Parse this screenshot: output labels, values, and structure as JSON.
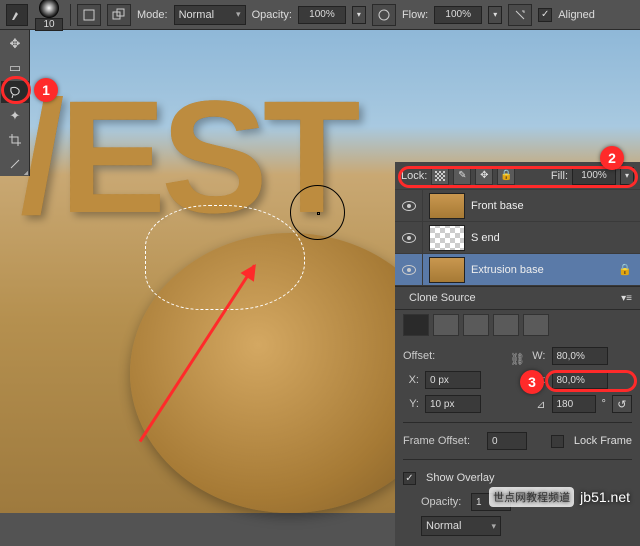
{
  "optbar": {
    "brush_size": "10",
    "mode_label": "Mode:",
    "mode_value": "Normal",
    "opacity_label": "Opacity:",
    "opacity_value": "100%",
    "flow_label": "Flow:",
    "flow_value": "100%",
    "aligned_label": "Aligned",
    "aligned_checked": true
  },
  "tools": [
    {
      "name": "move-tool",
      "glyph": "✥"
    },
    {
      "name": "marquee-tool",
      "glyph": "▭"
    },
    {
      "name": "lasso-tool",
      "glyph": "⌇",
      "selected": true
    },
    {
      "name": "magic-wand-tool",
      "glyph": "✦"
    },
    {
      "name": "crop-tool",
      "glyph": "✂"
    },
    {
      "name": "eyedropper-tool",
      "glyph": "✎"
    }
  ],
  "layers_panel": {
    "lock_label": "Lock:",
    "fill_label": "Fill:",
    "fill_value": "100%",
    "layers": [
      {
        "name": "Front base",
        "thumb": "hay",
        "selected": false,
        "locked": false
      },
      {
        "name": "S end",
        "thumb": "checker",
        "selected": false,
        "locked": false
      },
      {
        "name": "Extrusion base",
        "thumb": "hay",
        "selected": true,
        "locked": true
      }
    ]
  },
  "clone_source": {
    "tab_label": "Clone Source",
    "offset_label": "Offset:",
    "w_label": "W:",
    "w_value": "80,0%",
    "x_label": "X:",
    "x_value": "0 px",
    "h_label": "H:",
    "h_value": "80,0%",
    "y_label": "Y:",
    "y_value": "10 px",
    "angle_value": "180",
    "angle_unit": "°",
    "frame_offset_label": "Frame Offset:",
    "frame_offset_value": "0",
    "lock_frame_label": "Lock Frame",
    "lock_frame_checked": false,
    "show_overlay_label": "Show Overlay",
    "show_overlay_checked": true,
    "opacity_label": "Opacity:",
    "opacity_value": "1",
    "blend_value": "Normal"
  },
  "callouts": {
    "one": "1",
    "two": "2",
    "three": "3"
  },
  "watermark": {
    "sub": "世点网教程频道",
    "url": "jb51.net"
  },
  "canvas_text": "/EST"
}
